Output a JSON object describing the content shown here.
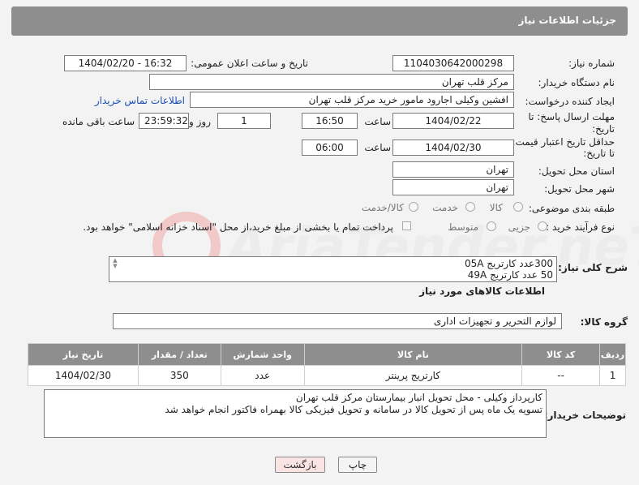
{
  "header": {
    "title": "جزئیات اطلاعات نیاز"
  },
  "fields": {
    "need_number_label": "شماره نیاز:",
    "need_number": "1104030642000298",
    "announce_label": "تاریخ و ساعت اعلان عمومی:",
    "announce_value": "1404/02/20 - 16:32",
    "buyer_org_label": "نام دستگاه خریدار:",
    "buyer_org": "مرکز قلب تهران",
    "creator_label": "ایجاد کننده درخواست:",
    "creator": "افشین وکیلی اجارود مامور خرید مرکز قلب تهران",
    "buyer_contact_link": "اطلاعات تماس خریدار",
    "deadline_label_1": "مهلت ارسال پاسخ: تا",
    "deadline_label_2": "تاریخ:",
    "deadline_date": "1404/02/22",
    "time_label": "ساعت",
    "deadline_time": "16:50",
    "days_value": "1",
    "days_label": "روز و",
    "remaining_time": "23:59:32",
    "remaining_label": "ساعت باقی مانده",
    "price_validity_label_1": "حداقل تاریخ اعتبار قیمت:",
    "price_validity_label_2": "تا تاریخ:",
    "price_validity_date": "1404/02/30",
    "price_validity_time": "06:00",
    "province_label": "استان محل تحویل:",
    "province": "تهران",
    "city_label": "شهر محل تحویل:",
    "city": "تهران",
    "category_label": "طبقه بندی موضوعی:",
    "category_options": [
      "کالا",
      "خدمت",
      "کالا/خدمت"
    ],
    "process_label": "نوع فرآیند خرید :",
    "process_options": [
      "جزیی",
      "متوسط"
    ],
    "payment_note": "پرداخت تمام یا بخشی از مبلغ خرید،از محل \"اسناد خزانه اسلامی\" خواهد بود."
  },
  "summary": {
    "label": "شرح کلی نیاز:",
    "lines": [
      "300عدد کارتریج 05A",
      "50 عدد کارتریج 49A"
    ]
  },
  "goods_section": {
    "title": "اطلاعات کالاهای مورد نیاز",
    "group_label": "گروه کالا:",
    "group_value": "لوازم التحریر و تجهیزات اداری"
  },
  "table": {
    "headers": [
      "ردیف",
      "کد کالا",
      "نام کالا",
      "واحد شمارش",
      "تعداد / مقدار",
      "تاریخ نیاز"
    ],
    "rows": [
      [
        "1",
        "--",
        "کارتریج پرینتر",
        "عدد",
        "350",
        "1404/02/30"
      ]
    ]
  },
  "buyer_notes": {
    "label": "توضیحات خریدار:",
    "lines": [
      "کارپرداز وکیلی - محل تحویل انبار بیمارستان مرکز قلب تهران",
      "تسویه یک ماه پس از تحویل کالا در سامانه و تحویل فیزیکی کالا بهمراه فاکتور انجام خواهد شد"
    ]
  },
  "buttons": {
    "print": "چاپ",
    "back": "بازگشت"
  },
  "watermark": {
    "text": "AriaTender.neT"
  }
}
